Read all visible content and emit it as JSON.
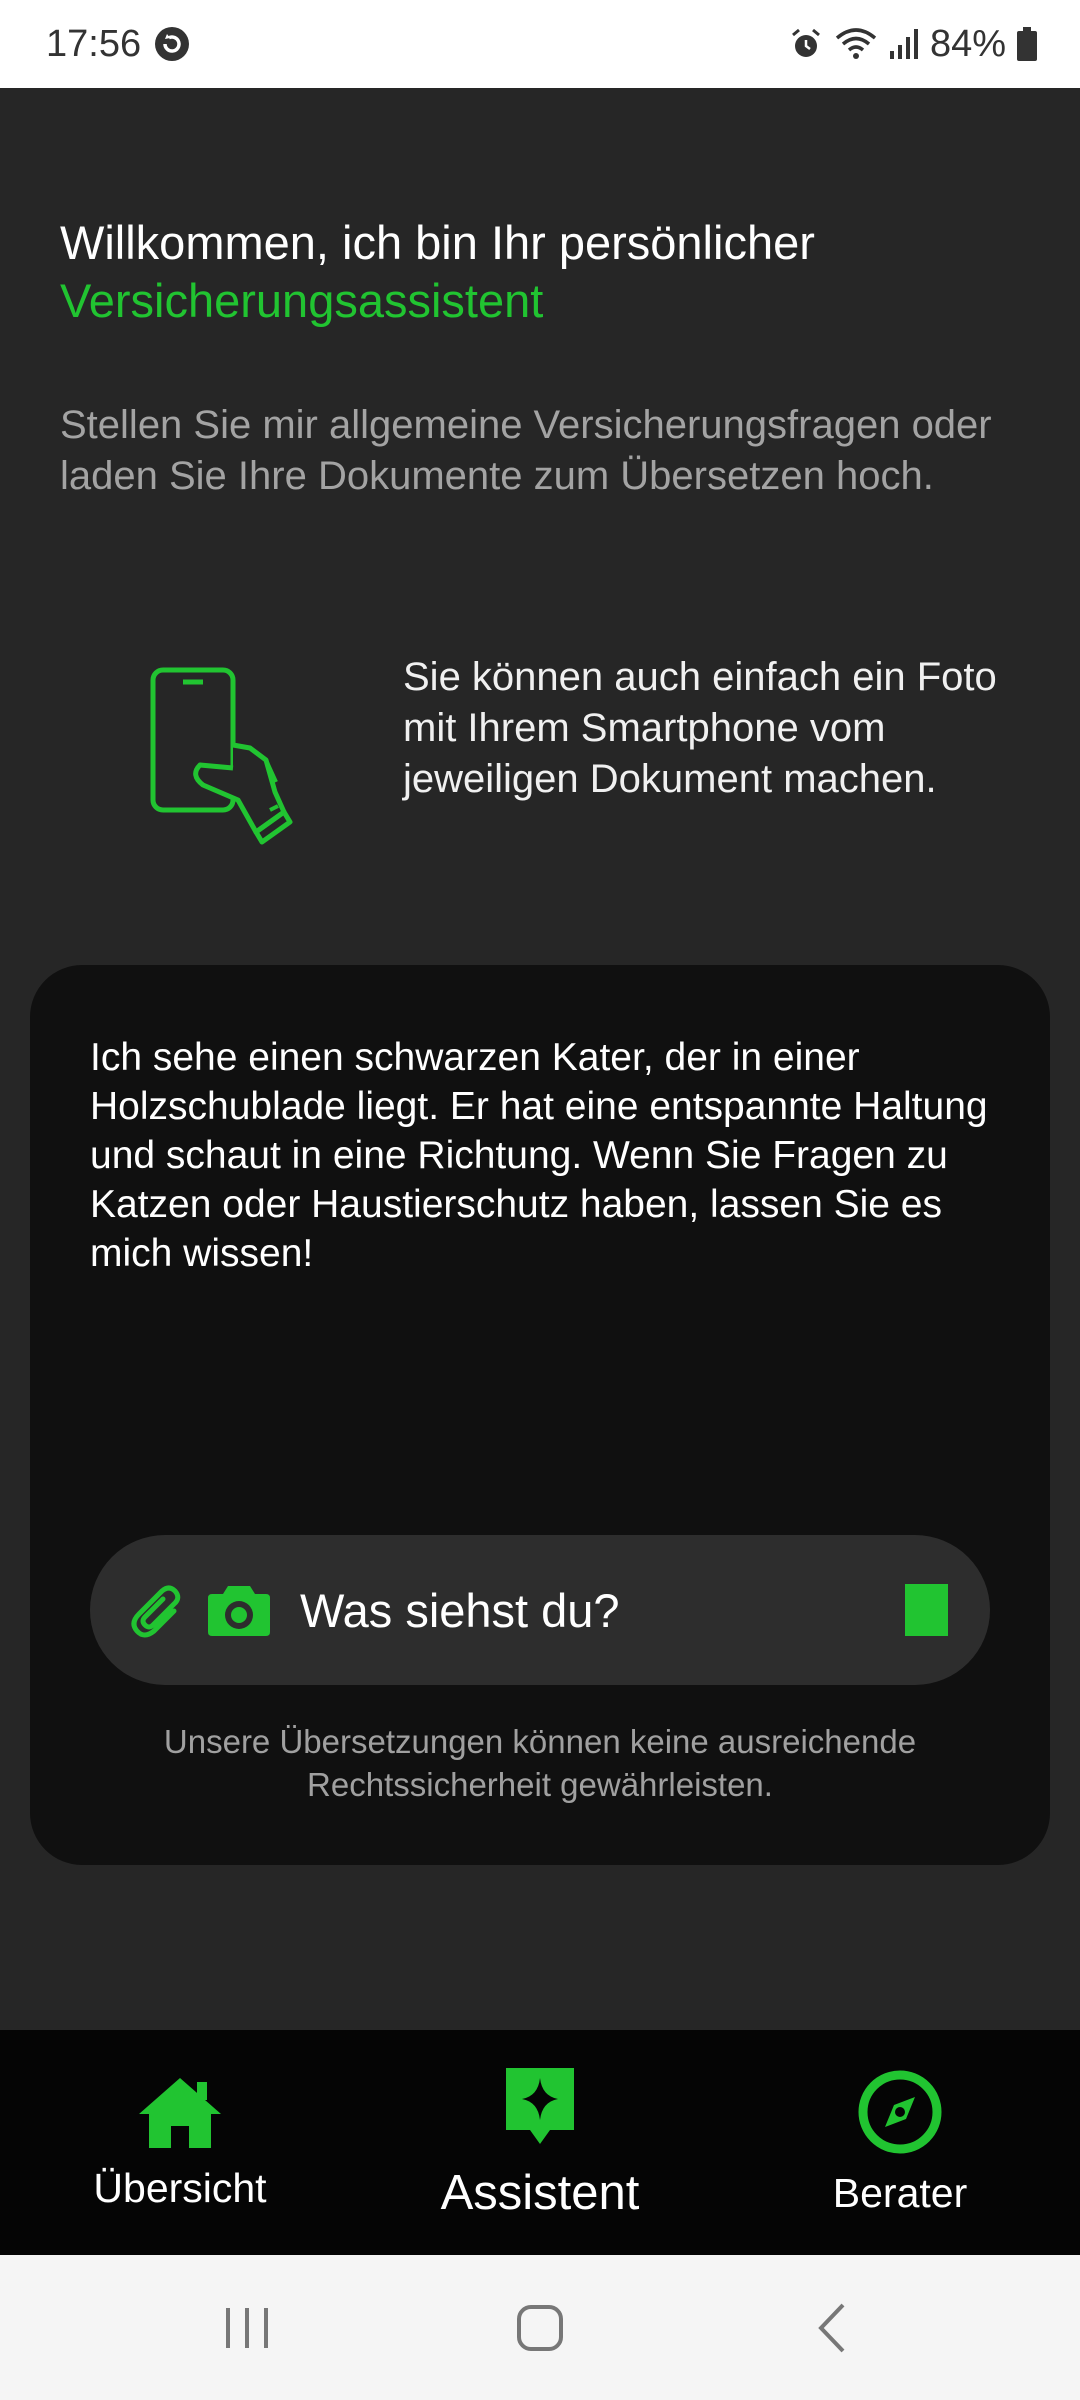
{
  "status_bar": {
    "time": "17:56",
    "battery": "84%",
    "icons": [
      "sync-icon",
      "alarm-icon",
      "wifi-icon",
      "signal-icon",
      "battery-icon"
    ]
  },
  "welcome": {
    "line1": "Willkommen, ich bin Ihr persönlicher",
    "line2": "Versicherungsassistent"
  },
  "intro": "Stellen Sie mir allgemeine Versicherungsfragen oder laden Sie Ihre Dokumente zum Übersetzen hoch.",
  "photo_tip": "Sie können auch einfach ein Foto mit Ihrem Smartphone vom jeweiligen Dokument machen.",
  "chat": {
    "response": "Ich sehe einen schwarzen Kater, der in einer Holzschublade liegt. Er hat eine entspannte Haltung und schaut in eine Richtung. Wenn Sie Fragen zu Katzen oder Haustierschutz haben, lassen Sie es mich wissen!",
    "input_value": "Was siehst du?",
    "disclaimer": "Unsere Übersetzungen können keine ausreichende Rechtssicherheit gewährleisten."
  },
  "bottom_nav": {
    "items": [
      {
        "label": "Übersicht",
        "icon": "home-icon"
      },
      {
        "label": "Assistent",
        "icon": "assistant-sparkle-icon",
        "active": true
      },
      {
        "label": "Berater",
        "icon": "compass-icon"
      }
    ]
  },
  "colors": {
    "accent": "#21c431",
    "background": "#262626",
    "card": "#101010",
    "nav": "#050505"
  }
}
